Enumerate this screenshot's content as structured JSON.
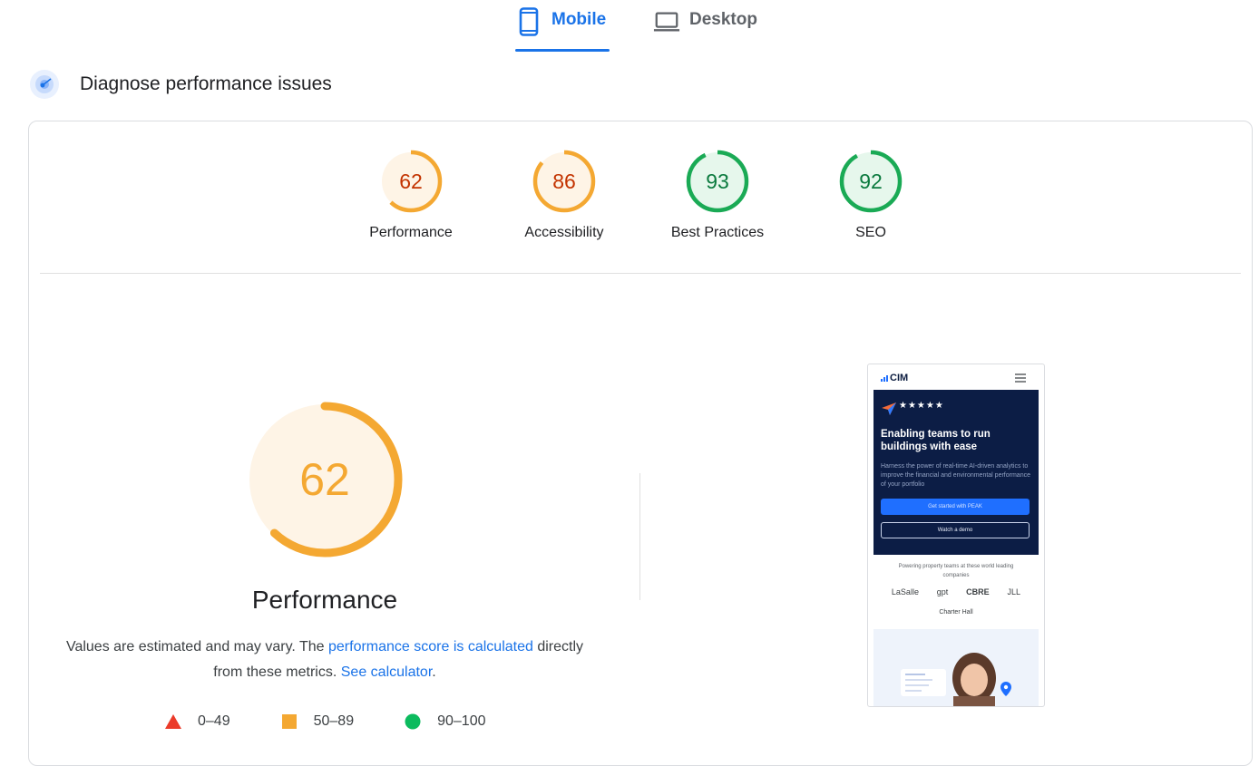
{
  "tabs": [
    {
      "label": "Mobile",
      "icon": "smartphone-icon",
      "selected": true
    },
    {
      "label": "Desktop",
      "icon": "laptop-icon",
      "selected": false
    }
  ],
  "section": {
    "title": "Diagnose performance issues",
    "icon": "diagnose-icon"
  },
  "gauges": [
    {
      "score": "62",
      "label": "Performance",
      "color": "#f4a832",
      "fill": "#fef4e6",
      "text_color": "#c33300",
      "value": 62
    },
    {
      "score": "86",
      "label": "Accessibility",
      "color": "#f4a832",
      "fill": "#fef4e6",
      "text_color": "#c33300",
      "value": 86
    },
    {
      "score": "93",
      "label": "Best Practices",
      "color": "#1aaa55",
      "fill": "#e6f7ec",
      "text_color": "#0b7a3e",
      "value": 93
    },
    {
      "score": "92",
      "label": "SEO",
      "color": "#1aaa55",
      "fill": "#e6f7ec",
      "text_color": "#0b7a3e",
      "value": 92
    }
  ],
  "performance": {
    "score": "62",
    "value": 62,
    "title": "Performance",
    "disclaimer_prefix": "Values are estimated and may vary. The ",
    "disclaimer_link1": "performance score is calculated",
    "disclaimer_middle": " directly from these metrics. ",
    "disclaimer_link2": "See calculator",
    "disclaimer_suffix": ".",
    "color": "#f4a832",
    "fill": "#fef4e6",
    "text_color": "#f4a832"
  },
  "legend": [
    {
      "range": "0–49",
      "shape": "triangle",
      "color": "#eb3b2a"
    },
    {
      "range": "50–89",
      "shape": "square",
      "color": "#f4a832"
    },
    {
      "range": "90–100",
      "shape": "circle",
      "color": "#0cbb5e"
    }
  ],
  "screenshot": {
    "logo": "CIM",
    "stars": "★★★★★",
    "heading": "Enabling teams to run buildings with ease",
    "subtext": "Harness the power of real-time AI-driven analytics to improve the financial and environmental performance of your portfolio",
    "primary_button": "Get started with PEAK",
    "secondary_button": "Watch a demo",
    "powering": "Powering property teams at these world leading companies",
    "logos": [
      "LaSalle",
      "gpt",
      "CBRE",
      "JLL"
    ],
    "charter": "Charter Hall"
  }
}
